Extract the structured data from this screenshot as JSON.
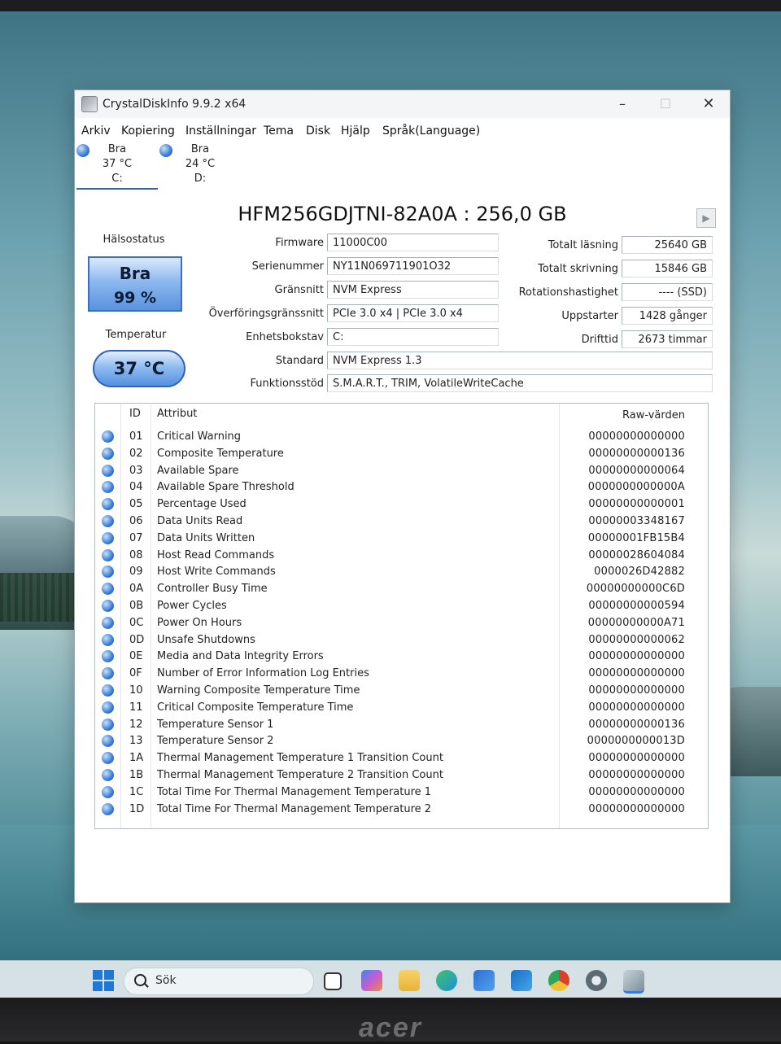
{
  "window": {
    "title": "CrystalDiskInfo 9.9.2 x64",
    "controls": {
      "minimize": "–",
      "maximize": "☐",
      "close": "✕"
    }
  },
  "menu": [
    "Arkiv",
    "Kopiering",
    "Inställningar",
    "Tema",
    "Disk",
    "Hjälp",
    "Språk(Language)"
  ],
  "disk_tabs": [
    {
      "status": "Bra",
      "temp": "37 °C",
      "drive": "C:",
      "active": true
    },
    {
      "status": "Bra",
      "temp": "24 °C",
      "drive": "D:",
      "active": false
    }
  ],
  "model": "HFM256GDJTNI-82A0A : 256,0 GB",
  "play_glyph": "▶",
  "health": {
    "label": "Hälsostatus",
    "status": "Bra",
    "percent": "99 %"
  },
  "temperature": {
    "label": "Temperatur",
    "value": "37 °C"
  },
  "info_left": [
    {
      "label": "Firmware",
      "value": "11000C00"
    },
    {
      "label": "Serienummer",
      "value": "NY11N069711901O32"
    },
    {
      "label": "Gränsnitt",
      "value": "NVM Express"
    },
    {
      "label": "Överföringsgränssnitt",
      "value": "PCIe 3.0 x4 | PCIe 3.0 x4"
    },
    {
      "label": "Enhetsbokstav",
      "value": "C:"
    }
  ],
  "info_right": [
    {
      "label": "Totalt läsning",
      "value": "25640 GB"
    },
    {
      "label": "Totalt skrivning",
      "value": "15846 GB"
    },
    {
      "label": "Rotationshastighet",
      "value": "---- (SSD)"
    },
    {
      "label": "Uppstarter",
      "value": "1428 gånger"
    },
    {
      "label": "Drifttid",
      "value": "2673 timmar"
    }
  ],
  "info_wide": [
    {
      "label": "Standard",
      "value": "NVM Express 1.3"
    },
    {
      "label": "Funktionsstöd",
      "value": "S.M.A.R.T., TRIM, VolatileWriteCache"
    }
  ],
  "table": {
    "headers": {
      "id": "ID",
      "attribute": "Attribut",
      "raw": "Raw-värden"
    },
    "rows": [
      {
        "id": "01",
        "name": "Critical Warning",
        "raw": "00000000000000"
      },
      {
        "id": "02",
        "name": "Composite Temperature",
        "raw": "00000000000136"
      },
      {
        "id": "03",
        "name": "Available Spare",
        "raw": "00000000000064"
      },
      {
        "id": "04",
        "name": "Available Spare Threshold",
        "raw": "0000000000000A"
      },
      {
        "id": "05",
        "name": "Percentage Used",
        "raw": "00000000000001"
      },
      {
        "id": "06",
        "name": "Data Units Read",
        "raw": "00000003348167"
      },
      {
        "id": "07",
        "name": "Data Units Written",
        "raw": "00000001FB15B4"
      },
      {
        "id": "08",
        "name": "Host Read Commands",
        "raw": "00000028604084"
      },
      {
        "id": "09",
        "name": "Host Write Commands",
        "raw": "0000026D42882"
      },
      {
        "id": "0A",
        "name": "Controller Busy Time",
        "raw": "00000000000C6D"
      },
      {
        "id": "0B",
        "name": "Power Cycles",
        "raw": "00000000000594"
      },
      {
        "id": "0C",
        "name": "Power On Hours",
        "raw": "00000000000A71"
      },
      {
        "id": "0D",
        "name": "Unsafe Shutdowns",
        "raw": "00000000000062"
      },
      {
        "id": "0E",
        "name": "Media and Data Integrity Errors",
        "raw": "00000000000000"
      },
      {
        "id": "0F",
        "name": "Number of Error Information Log Entries",
        "raw": "00000000000000"
      },
      {
        "id": "10",
        "name": "Warning Composite Temperature Time",
        "raw": "00000000000000"
      },
      {
        "id": "11",
        "name": "Critical Composite Temperature Time",
        "raw": "00000000000000"
      },
      {
        "id": "12",
        "name": "Temperature Sensor 1",
        "raw": "00000000000136"
      },
      {
        "id": "13",
        "name": "Temperature Sensor 2",
        "raw": "0000000000013D"
      },
      {
        "id": "1A",
        "name": "Thermal Management Temperature 1 Transition Count",
        "raw": "00000000000000"
      },
      {
        "id": "1B",
        "name": "Thermal Management Temperature 2 Transition Count",
        "raw": "00000000000000"
      },
      {
        "id": "1C",
        "name": "Total Time For Thermal Management Temperature 1",
        "raw": "00000000000000"
      },
      {
        "id": "1D",
        "name": "Total Time For Thermal Management Temperature 2",
        "raw": "00000000000000"
      }
    ]
  },
  "taskbar": {
    "search_placeholder": "Sök",
    "icons": [
      "start-icon",
      "search-icon",
      "task-view-icon",
      "copilot-icon",
      "file-explorer-icon",
      "edge-icon",
      "store-icon",
      "outlook-icon",
      "chrome-icon",
      "settings-icon",
      "crystaldiskinfo-icon"
    ],
    "icon_colors": [
      "#1f78d1",
      "#222222",
      "#333333",
      "#c45bd6",
      "#e8b434",
      "#1d8fd6",
      "#2e6fd1",
      "#1a6fc4",
      "#d9412f",
      "#5b6a74",
      "#7a8e9a"
    ]
  },
  "monitor_brand": "acer"
}
